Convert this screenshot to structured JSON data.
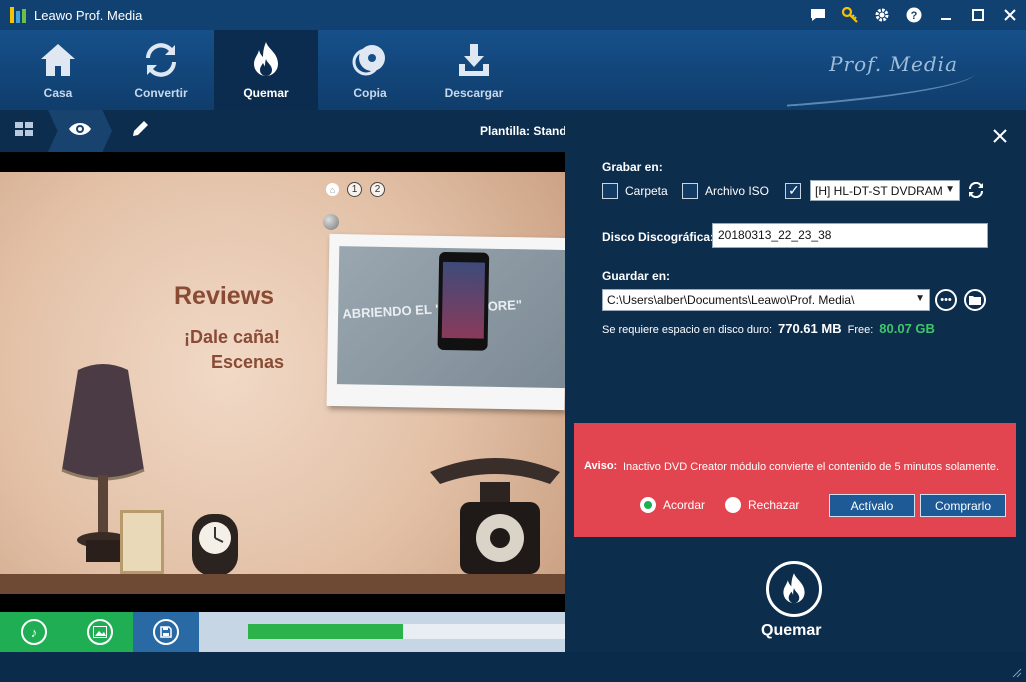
{
  "app": {
    "title": "Leawo Prof. Media",
    "brand": "Prof. Media"
  },
  "titlebar": {
    "icons": [
      "chat-icon",
      "key-icon",
      "gear-icon",
      "help-icon"
    ],
    "window_controls": [
      "minimize",
      "maximize",
      "close"
    ]
  },
  "nav": {
    "items": [
      {
        "label": "Casa",
        "icon": "home-icon"
      },
      {
        "label": "Convertir",
        "icon": "convert-icon"
      },
      {
        "label": "Quemar",
        "icon": "flame-icon",
        "active": true
      },
      {
        "label": "Copia",
        "icon": "disc-icon"
      },
      {
        "label": "Descargar",
        "icon": "download-icon"
      }
    ]
  },
  "toolrow": {
    "template_label": "Plantilla: Standa",
    "tools": [
      "grid-icon",
      "eye-icon",
      "pencil-icon"
    ]
  },
  "preview": {
    "pager": [
      "1",
      "2"
    ],
    "title": "Reviews",
    "subtitle1": "¡Dale caña!",
    "subtitle2": "Escenas",
    "photo_text": "ABRIENDO EL \"APP STORE\""
  },
  "bottombar": {
    "icons": [
      "music-icon",
      "image-icon",
      "save-icon"
    ],
    "progress": 0.49
  },
  "panel": {
    "burn_to_label": "Grabar en:",
    "folder_label": "Carpeta",
    "iso_label": "Archivo ISO",
    "folder_checked": false,
    "iso_checked": false,
    "drive_checked": true,
    "drive_value": "[H] HL-DT-ST DVDRAM",
    "disc_label_title": "Disco Discográfica:",
    "disc_label_value": "20180313_22_23_38",
    "save_to_label": "Guardar en:",
    "save_path": "C:\\Users\\alber\\Documents\\Leawo\\Prof. Media\\",
    "space_required_label": "Se requiere espacio en disco duro:",
    "space_required_value": "770.61 MB",
    "free_label": "Free:",
    "free_value": "80.07 GB",
    "burn_label": "Quemar"
  },
  "warning": {
    "label": "Aviso:",
    "text": "Inactivo DVD Creator módulo convierte el contenido de 5 minutos solamente.",
    "accept": "Acordar",
    "reject": "Rechazar",
    "accept_selected": true,
    "activate_button": "Actívalo",
    "buy_button": "Comprarlo"
  },
  "colors": {
    "accent_green": "#1fae54",
    "warning_red": "#e2454f",
    "nav_blue": "#16508a",
    "free_green": "#3fc66a"
  }
}
